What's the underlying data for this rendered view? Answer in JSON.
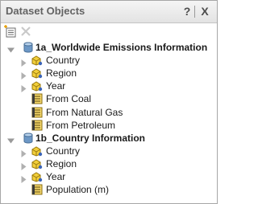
{
  "panel": {
    "title": "Dataset Objects",
    "help_label": "?",
    "close_label": "X"
  },
  "toolbar": {
    "new_icon": "new-object-icon",
    "delete_icon": "delete-icon"
  },
  "datasets": [
    {
      "name": "1a_Worldwide Emissions Information",
      "expanded": true,
      "items": [
        {
          "label": "Country",
          "type": "attribute",
          "expandable": true
        },
        {
          "label": "Region",
          "type": "attribute",
          "expandable": true
        },
        {
          "label": "Year",
          "type": "attribute",
          "expandable": true
        },
        {
          "label": "From Coal",
          "type": "metric",
          "expandable": false
        },
        {
          "label": "From Natural Gas",
          "type": "metric",
          "expandable": false
        },
        {
          "label": "From Petroleum",
          "type": "metric",
          "expandable": false
        }
      ]
    },
    {
      "name": "1b_Country Information",
      "expanded": true,
      "items": [
        {
          "label": "Country",
          "type": "attribute",
          "expandable": true
        },
        {
          "label": "Region",
          "type": "attribute",
          "expandable": true
        },
        {
          "label": "Year",
          "type": "attribute",
          "expandable": true
        },
        {
          "label": "Population (m)",
          "type": "metric",
          "expandable": false
        }
      ]
    }
  ]
}
